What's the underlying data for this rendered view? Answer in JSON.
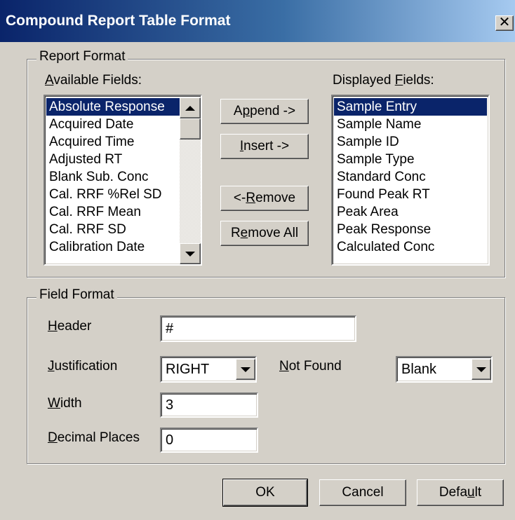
{
  "window": {
    "title": "Compound Report Table Format",
    "close_glyph": "✕"
  },
  "report_format": {
    "legend": "Report Format",
    "available_label_pre": "",
    "available_label_key": "A",
    "available_label_post": "vailable Fields:",
    "available_fields": [
      "Absolute Response",
      "Acquired Date",
      "Acquired Time",
      "Adjusted RT",
      "Blank Sub. Conc",
      "Cal. RRF %Rel SD",
      "Cal. RRF Mean",
      "Cal. RRF SD",
      "Calibration Date"
    ],
    "available_selected_index": 0,
    "displayed_label_pre": "Displayed ",
    "displayed_label_key": "F",
    "displayed_label_post": "ields:",
    "displayed_fields": [
      "Sample Entry",
      "Sample Name",
      "Sample ID",
      "Sample Type",
      "Standard Conc",
      "Found Peak RT",
      "Peak Area",
      "Peak Response",
      "Calculated Conc"
    ],
    "displayed_selected_index": 0,
    "buttons": {
      "append_pre": "A",
      "append_key": "p",
      "append_post": "pend ->",
      "insert_pre": "",
      "insert_key": "I",
      "insert_post": "nsert ->",
      "remove_pre": "<- ",
      "remove_key": "R",
      "remove_post": "emove",
      "remove_all_pre": "R",
      "remove_all_key": "e",
      "remove_all_post": "move All"
    }
  },
  "field_format": {
    "legend": "Field Format",
    "header_label_key": "H",
    "header_label_post": "eader",
    "header_value": "#",
    "justification_label_key": "J",
    "justification_label_post": "ustification",
    "justification_value": "RIGHT",
    "not_found_label_key": "N",
    "not_found_label_post": "ot Found",
    "not_found_value": "Blank",
    "width_label_key": "W",
    "width_label_post": "idth",
    "width_value": "3",
    "decimal_label_key": "D",
    "decimal_label_post": "ecimal Places",
    "decimal_value": "0"
  },
  "footer": {
    "ok_label": "OK",
    "cancel_label": "Cancel",
    "default_pre": "Defa",
    "default_key": "u",
    "default_post": "lt"
  },
  "icons": {
    "scroll_up": "scroll-up-arrow-icon",
    "scroll_down": "scroll-down-arrow-icon",
    "dropdown": "dropdown-arrow-icon"
  },
  "colors": {
    "dialog_bg": "#d4d0c8",
    "title_start": "#0a246a",
    "title_end": "#a6caf0",
    "selection": "#0a246a"
  }
}
